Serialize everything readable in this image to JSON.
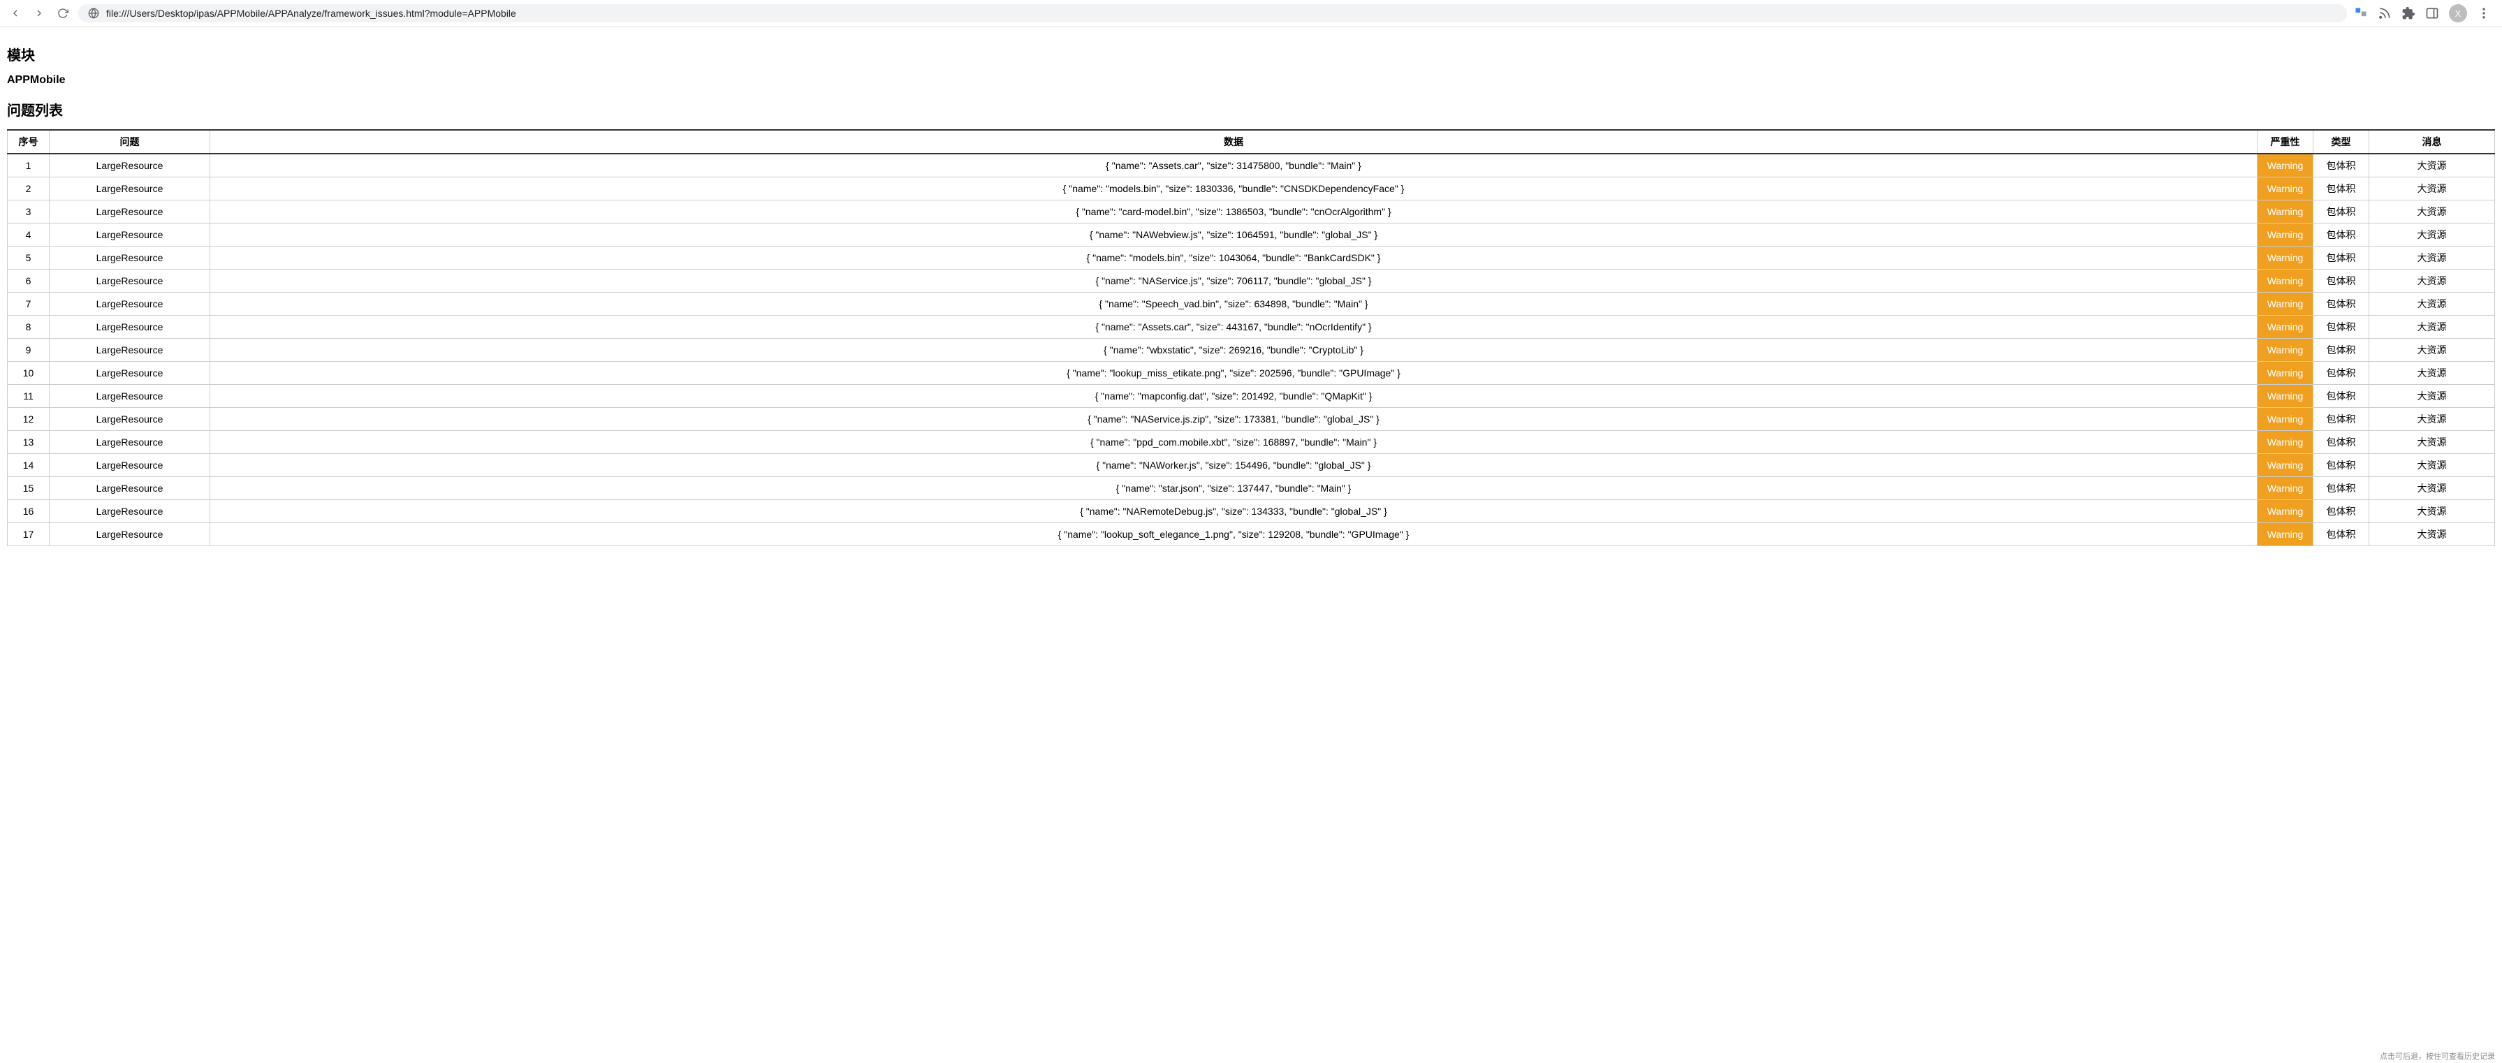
{
  "browser": {
    "url": "file:///Users/Desktop/ipas/APPMobile/APPAnalyze/framework_issues.html?module=APPMobile",
    "avatar_letter": "X"
  },
  "page": {
    "section_title": "模块",
    "module_name": "APPMobile",
    "list_title": "问题列表"
  },
  "table": {
    "headers": {
      "index": "序号",
      "issue": "问题",
      "data": "数据",
      "severity": "严重性",
      "type": "类型",
      "message": "消息"
    },
    "rows": [
      {
        "index": "1",
        "issue": "LargeResource",
        "data": "{ \"name\": \"Assets.car\", \"size\": 31475800, \"bundle\": \"Main\" }",
        "severity": "Warning",
        "type": "包体积",
        "message": "大资源"
      },
      {
        "index": "2",
        "issue": "LargeResource",
        "data": "{ \"name\": \"models.bin\", \"size\": 1830336, \"bundle\": \"CNSDKDependencyFace\" }",
        "severity": "Warning",
        "type": "包体积",
        "message": "大资源"
      },
      {
        "index": "3",
        "issue": "LargeResource",
        "data": "{ \"name\": \"card-model.bin\", \"size\": 1386503, \"bundle\": \"cnOcrAlgorithm\" }",
        "severity": "Warning",
        "type": "包体积",
        "message": "大资源"
      },
      {
        "index": "4",
        "issue": "LargeResource",
        "data": "{ \"name\": \"NAWebview.js\", \"size\": 1064591, \"bundle\": \"global_JS\" }",
        "severity": "Warning",
        "type": "包体积",
        "message": "大资源"
      },
      {
        "index": "5",
        "issue": "LargeResource",
        "data": "{ \"name\": \"models.bin\", \"size\": 1043064, \"bundle\": \"BankCardSDK\" }",
        "severity": "Warning",
        "type": "包体积",
        "message": "大资源"
      },
      {
        "index": "6",
        "issue": "LargeResource",
        "data": "{ \"name\": \"NAService.js\", \"size\": 706117, \"bundle\": \"global_JS\" }",
        "severity": "Warning",
        "type": "包体积",
        "message": "大资源"
      },
      {
        "index": "7",
        "issue": "LargeResource",
        "data": "{ \"name\": \"Speech_vad.bin\", \"size\": 634898, \"bundle\": \"Main\" }",
        "severity": "Warning",
        "type": "包体积",
        "message": "大资源"
      },
      {
        "index": "8",
        "issue": "LargeResource",
        "data": "{ \"name\": \"Assets.car\", \"size\": 443167, \"bundle\": \"nOcrIdentify\" }",
        "severity": "Warning",
        "type": "包体积",
        "message": "大资源"
      },
      {
        "index": "9",
        "issue": "LargeResource",
        "data": "{ \"name\": \"wbxstatic\", \"size\": 269216, \"bundle\": \"CryptoLib\" }",
        "severity": "Warning",
        "type": "包体积",
        "message": "大资源"
      },
      {
        "index": "10",
        "issue": "LargeResource",
        "data": "{ \"name\": \"lookup_miss_etikate.png\", \"size\": 202596, \"bundle\": \"GPUImage\" }",
        "severity": "Warning",
        "type": "包体积",
        "message": "大资源"
      },
      {
        "index": "11",
        "issue": "LargeResource",
        "data": "{ \"name\": \"mapconfig.dat\", \"size\": 201492, \"bundle\": \"QMapKit\" }",
        "severity": "Warning",
        "type": "包体积",
        "message": "大资源"
      },
      {
        "index": "12",
        "issue": "LargeResource",
        "data": "{ \"name\": \"NAService.js.zip\", \"size\": 173381, \"bundle\": \"global_JS\" }",
        "severity": "Warning",
        "type": "包体积",
        "message": "大资源"
      },
      {
        "index": "13",
        "issue": "LargeResource",
        "data": "{ \"name\": \"ppd_com.mobile.xbt\", \"size\": 168897, \"bundle\": \"Main\" }",
        "severity": "Warning",
        "type": "包体积",
        "message": "大资源"
      },
      {
        "index": "14",
        "issue": "LargeResource",
        "data": "{ \"name\": \"NAWorker.js\", \"size\": 154496, \"bundle\": \"global_JS\" }",
        "severity": "Warning",
        "type": "包体积",
        "message": "大资源"
      },
      {
        "index": "15",
        "issue": "LargeResource",
        "data": "{ \"name\": \"star.json\", \"size\": 137447, \"bundle\": \"Main\" }",
        "severity": "Warning",
        "type": "包体积",
        "message": "大资源"
      },
      {
        "index": "16",
        "issue": "LargeResource",
        "data": "{ \"name\": \"NARemoteDebug.js\", \"size\": 134333, \"bundle\": \"global_JS\" }",
        "severity": "Warning",
        "type": "包体积",
        "message": "大资源"
      },
      {
        "index": "17",
        "issue": "LargeResource",
        "data": "{ \"name\": \"lookup_soft_elegance_1.png\", \"size\": 129208, \"bundle\": \"GPUImage\" }",
        "severity": "Warning",
        "type": "包体积",
        "message": "大资源"
      }
    ]
  },
  "footer_hint": "点击可后退，按住可查看历史记录"
}
